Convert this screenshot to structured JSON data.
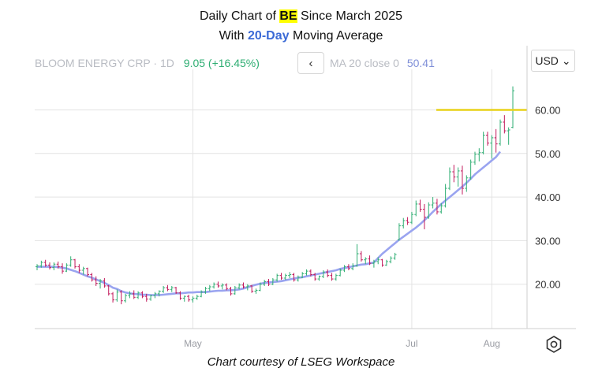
{
  "header": {
    "line1_prefix": "Daily Chart of ",
    "ticker": "BE",
    "line1_suffix": " Since March 2025",
    "line2_prefix": "With ",
    "ma_period": "20-Day",
    "line2_suffix": " Moving Average"
  },
  "legend": {
    "instrument": "BLOOM ENERGY CRP",
    "interval": "1D",
    "change": "9.05 (+16.45%)",
    "ma_label": "MA 20 close 0",
    "ma_value": "50.41"
  },
  "controls": {
    "back_glyph": "‹",
    "currency": "USD",
    "currency_glyph": "⌄",
    "settings_icon": "gear-icon"
  },
  "credit": "Chart courtesy of LSEG Workspace",
  "colors": {
    "up": "#2fae73",
    "down": "#c2185b",
    "ma": "#9aa4f0",
    "resistance": "#e8d21a",
    "grid": "#e3e3e3"
  },
  "chart_data": {
    "type": "candlestick",
    "title": "Daily Chart of BE Since March 2025",
    "subtitle": "With 20-Day Moving Average",
    "yticks": [
      20,
      30,
      40,
      50,
      60
    ],
    "ytick_labels": [
      "20.00",
      "30.00",
      "40.00",
      "50.00",
      "60.00"
    ],
    "ylim": [
      10,
      70
    ],
    "xtick_labels": [
      "May",
      "Jul",
      "Aug"
    ],
    "xtick_index": [
      37,
      89,
      108
    ],
    "resistance_level": 60,
    "series": [
      {
        "name": "BLOOM ENERGY CRP",
        "ohlc": [
          [
            24.0,
            24.6,
            23.2,
            24.2
          ],
          [
            24.2,
            25.4,
            23.8,
            25.0
          ],
          [
            25.0,
            25.6,
            24.0,
            24.4
          ],
          [
            24.4,
            25.0,
            23.4,
            23.8
          ],
          [
            23.8,
            25.0,
            23.2,
            24.6
          ],
          [
            24.6,
            25.2,
            23.6,
            24.0
          ],
          [
            24.0,
            24.8,
            22.4,
            23.0
          ],
          [
            23.0,
            24.8,
            22.8,
            24.4
          ],
          [
            24.4,
            26.4,
            24.0,
            25.6
          ],
          [
            25.6,
            25.8,
            23.6,
            24.0
          ],
          [
            24.0,
            24.6,
            22.6,
            23.2
          ],
          [
            23.2,
            24.0,
            22.2,
            23.6
          ],
          [
            23.6,
            23.8,
            21.8,
            22.2
          ],
          [
            22.2,
            22.6,
            20.6,
            21.0
          ],
          [
            21.0,
            21.8,
            19.6,
            20.2
          ],
          [
            20.2,
            21.2,
            19.0,
            20.8
          ],
          [
            20.8,
            21.4,
            19.2,
            19.6
          ],
          [
            19.6,
            19.8,
            17.4,
            17.8
          ],
          [
            17.8,
            18.2,
            15.8,
            16.4
          ],
          [
            16.4,
            18.8,
            16.0,
            18.2
          ],
          [
            18.2,
            18.6,
            15.4,
            16.2
          ],
          [
            16.2,
            17.8,
            15.8,
            17.4
          ],
          [
            17.4,
            18.4,
            16.8,
            17.8
          ],
          [
            17.8,
            18.6,
            16.6,
            17.0
          ],
          [
            17.0,
            18.4,
            16.6,
            18.0
          ],
          [
            18.0,
            18.4,
            16.8,
            17.2
          ],
          [
            17.2,
            17.8,
            16.0,
            16.6
          ],
          [
            16.6,
            17.6,
            16.2,
            17.4
          ],
          [
            17.4,
            18.2,
            16.8,
            17.8
          ],
          [
            17.8,
            18.6,
            17.2,
            18.4
          ],
          [
            18.4,
            19.6,
            18.0,
            19.2
          ],
          [
            19.2,
            19.8,
            18.4,
            18.8
          ],
          [
            18.8,
            19.6,
            18.2,
            19.2
          ],
          [
            19.2,
            19.4,
            17.8,
            18.0
          ],
          [
            18.0,
            18.4,
            16.4,
            16.8
          ],
          [
            16.8,
            17.4,
            16.0,
            17.2
          ],
          [
            17.2,
            17.6,
            16.0,
            16.4
          ],
          [
            16.4,
            17.2,
            15.8,
            16.8
          ],
          [
            16.8,
            17.6,
            16.4,
            17.2
          ],
          [
            17.2,
            18.6,
            17.0,
            18.2
          ],
          [
            18.2,
            19.4,
            17.8,
            19.0
          ],
          [
            19.0,
            19.8,
            18.4,
            19.4
          ],
          [
            19.4,
            20.4,
            19.0,
            20.0
          ],
          [
            20.0,
            20.6,
            19.2,
            19.6
          ],
          [
            19.6,
            20.2,
            18.8,
            19.8
          ],
          [
            19.8,
            20.2,
            18.6,
            19.0
          ],
          [
            19.0,
            19.4,
            17.4,
            17.8
          ],
          [
            17.8,
            19.6,
            17.6,
            19.2
          ],
          [
            19.2,
            20.2,
            18.8,
            19.8
          ],
          [
            19.8,
            20.4,
            19.0,
            19.4
          ],
          [
            19.4,
            20.0,
            18.6,
            19.6
          ],
          [
            19.6,
            19.8,
            18.0,
            18.4
          ],
          [
            18.4,
            19.0,
            17.8,
            18.6
          ],
          [
            18.6,
            20.4,
            18.4,
            20.0
          ],
          [
            20.0,
            21.0,
            19.6,
            20.6
          ],
          [
            20.6,
            21.2,
            19.6,
            20.0
          ],
          [
            20.0,
            21.4,
            19.8,
            21.0
          ],
          [
            21.0,
            22.4,
            20.6,
            22.0
          ],
          [
            22.0,
            22.6,
            21.0,
            21.4
          ],
          [
            21.4,
            22.4,
            21.0,
            22.0
          ],
          [
            22.0,
            22.8,
            21.4,
            22.2
          ],
          [
            22.2,
            22.6,
            20.6,
            21.0
          ],
          [
            21.0,
            22.0,
            20.6,
            21.6
          ],
          [
            21.6,
            22.8,
            21.4,
            22.4
          ],
          [
            22.4,
            23.4,
            22.0,
            23.0
          ],
          [
            23.0,
            23.4,
            21.8,
            22.2
          ],
          [
            22.2,
            22.6,
            20.8,
            21.2
          ],
          [
            21.2,
            22.0,
            20.8,
            21.8
          ],
          [
            21.8,
            23.2,
            21.4,
            22.8
          ],
          [
            22.8,
            23.4,
            21.6,
            22.0
          ],
          [
            22.0,
            22.6,
            20.8,
            21.2
          ],
          [
            21.2,
            22.4,
            20.8,
            22.0
          ],
          [
            22.0,
            23.6,
            21.8,
            23.2
          ],
          [
            23.2,
            24.4,
            22.8,
            24.0
          ],
          [
            24.0,
            24.6,
            23.2,
            23.6
          ],
          [
            23.6,
            24.8,
            23.2,
            24.2
          ],
          [
            24.2,
            29.2,
            24.0,
            27.0
          ],
          [
            27.0,
            27.6,
            25.2,
            25.6
          ],
          [
            25.6,
            26.2,
            24.6,
            25.8
          ],
          [
            25.8,
            26.6,
            24.4,
            24.8
          ],
          [
            24.8,
            25.6,
            23.8,
            25.2
          ],
          [
            25.2,
            26.2,
            24.6,
            25.6
          ],
          [
            25.6,
            25.8,
            24.0,
            24.4
          ],
          [
            24.4,
            25.6,
            24.2,
            25.2
          ],
          [
            25.2,
            26.4,
            24.8,
            26.0
          ],
          [
            26.0,
            27.2,
            25.6,
            26.8
          ],
          [
            30.2,
            34.0,
            30.0,
            33.4
          ],
          [
            33.4,
            35.2,
            32.8,
            34.6
          ],
          [
            34.6,
            35.4,
            33.6,
            34.2
          ],
          [
            34.2,
            36.6,
            33.8,
            36.0
          ],
          [
            36.0,
            39.2,
            35.6,
            38.4
          ],
          [
            38.4,
            39.4,
            36.6,
            37.2
          ],
          [
            37.2,
            38.4,
            32.6,
            35.4
          ],
          [
            35.4,
            38.8,
            35.0,
            38.2
          ],
          [
            38.2,
            40.0,
            37.4,
            38.6
          ],
          [
            38.6,
            39.6,
            36.0,
            36.6
          ],
          [
            36.6,
            38.6,
            36.2,
            38.0
          ],
          [
            38.0,
            43.0,
            37.6,
            42.0
          ],
          [
            42.0,
            46.8,
            41.6,
            45.8
          ],
          [
            45.8,
            47.4,
            43.4,
            44.6
          ],
          [
            44.6,
            46.8,
            42.4,
            46.0
          ],
          [
            46.0,
            47.2,
            40.6,
            42.0
          ],
          [
            42.0,
            45.0,
            41.2,
            44.4
          ],
          [
            44.4,
            48.6,
            44.0,
            48.0
          ],
          [
            48.0,
            50.4,
            47.4,
            49.8
          ],
          [
            49.8,
            51.2,
            48.2,
            50.2
          ],
          [
            50.2,
            55.0,
            49.8,
            54.2
          ],
          [
            54.2,
            55.0,
            51.8,
            52.4
          ],
          [
            52.4,
            54.2,
            48.8,
            53.6
          ],
          [
            53.6,
            55.6,
            50.2,
            52.2
          ],
          [
            52.2,
            57.8,
            51.8,
            57.2
          ],
          [
            57.2,
            58.8,
            54.6,
            55.2
          ],
          [
            55.2,
            56.0,
            52.0,
            55.4
          ],
          [
            56.0,
            65.4,
            55.8,
            64.4
          ]
        ]
      },
      {
        "name": "MA 20 close 0",
        "values": [
          24.0,
          24.0,
          24.0,
          24.0,
          24.0,
          23.9,
          23.8,
          23.6,
          23.3,
          23.0,
          22.6,
          22.2,
          21.8,
          21.5,
          21.1,
          20.7,
          20.3,
          19.8,
          19.2,
          18.9,
          18.4,
          18.1,
          17.9,
          17.8,
          17.7,
          17.6,
          17.6,
          17.5,
          17.5,
          17.5,
          17.6,
          17.7,
          17.8,
          17.9,
          17.9,
          18.0,
          18.1,
          18.1,
          18.2,
          18.2,
          18.2,
          18.3,
          18.4,
          18.5,
          18.5,
          18.6,
          18.6,
          18.7,
          18.8,
          19.0,
          19.3,
          19.6,
          19.9,
          20.1,
          20.3,
          20.4,
          20.5,
          20.6,
          20.7,
          20.9,
          21.1,
          21.3,
          21.5,
          21.6,
          21.8,
          22.0,
          22.2,
          22.4,
          22.6,
          22.8,
          23.0,
          23.2,
          23.5,
          23.7,
          23.9,
          24.1,
          24.3,
          24.5,
          24.6,
          24.8,
          25.0,
          26.0,
          27.0,
          27.8,
          28.6,
          29.4,
          30.2,
          30.9,
          31.6,
          32.3,
          33.0,
          33.8,
          34.7,
          35.6,
          36.6,
          37.5,
          38.4,
          39.2,
          40.0,
          40.8,
          41.6,
          42.4,
          43.3,
          44.2,
          45.2,
          46.0,
          46.8,
          47.6,
          48.4,
          49.2,
          50.41
        ],
        "color": "#9aa4f0"
      }
    ]
  }
}
